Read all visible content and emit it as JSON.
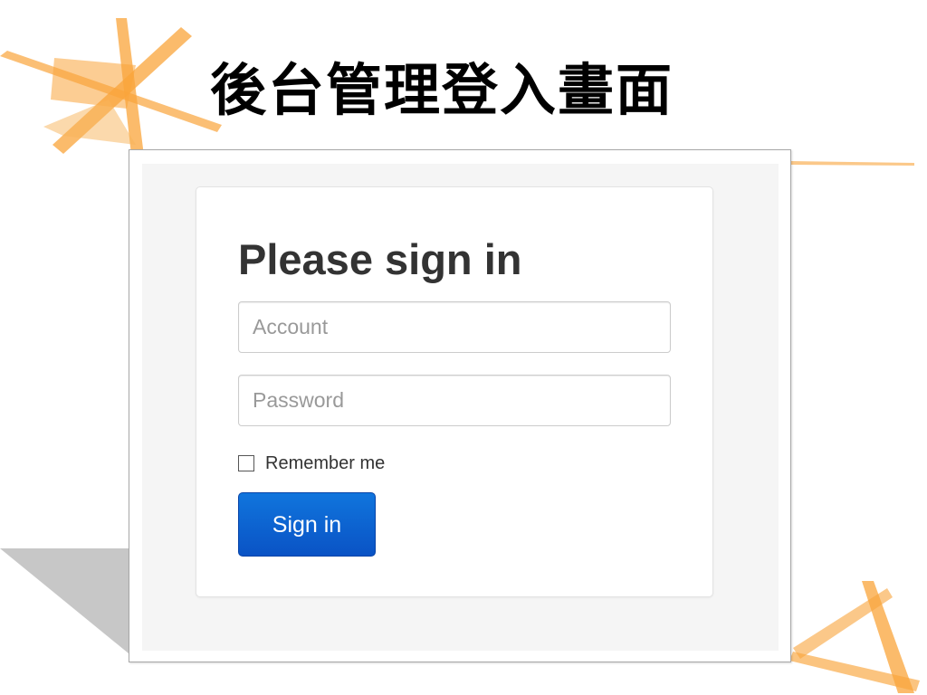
{
  "slide": {
    "title": "後台管理登入畫面"
  },
  "login": {
    "heading": "Please sign in",
    "account_placeholder": "Account",
    "account_value": "",
    "password_placeholder": "Password",
    "password_value": "",
    "remember_label": "Remember me",
    "remember_checked": false,
    "signin_label": "Sign in"
  },
  "colors": {
    "primary_button": "#0a5fd4",
    "card_background": "#ffffff",
    "page_background": "#f5f5f5",
    "decoration_orange": "#f9a43a",
    "decoration_shadow": "#bdbdbd"
  }
}
